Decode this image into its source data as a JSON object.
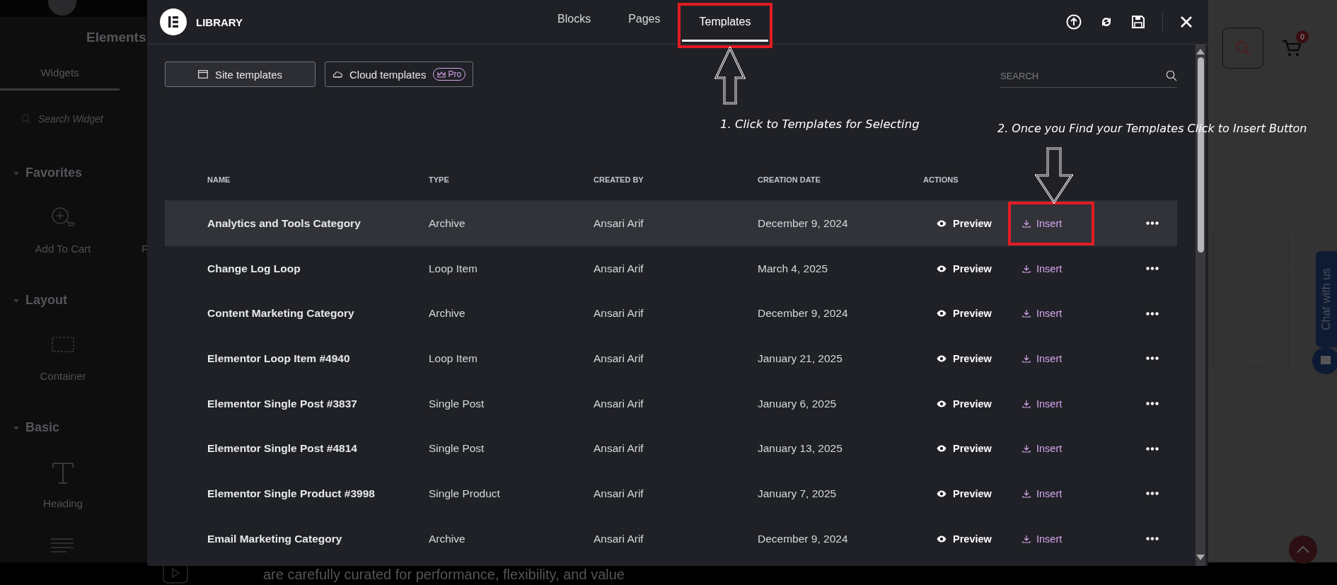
{
  "editor": {
    "panel_title": "Elements",
    "tabs": [
      {
        "label": "Widgets",
        "selected": true
      }
    ],
    "search": {
      "placeholder": "Search Widget"
    },
    "categories": [
      {
        "title": "Favorites",
        "expanded": true,
        "widgets": [
          {
            "label": "Add To Cart",
            "kind": "cart"
          },
          {
            "label": "F",
            "kind": "none"
          }
        ]
      },
      {
        "title": "Layout",
        "expanded": true,
        "widgets": [
          {
            "label": "Container",
            "kind": "container"
          }
        ]
      },
      {
        "title": "Basic",
        "expanded": true,
        "widgets": [
          {
            "label": "Heading",
            "kind": "heading"
          }
        ]
      }
    ]
  },
  "page": {
    "cart_count": "0",
    "body_text": "are carefully curated for performance, flexibility, and value",
    "chat_label": "Chat with us"
  },
  "library": {
    "title": "LIBRARY",
    "tabs": [
      {
        "label": "Blocks",
        "selected": false,
        "highlighted": false
      },
      {
        "label": "Pages",
        "selected": false,
        "highlighted": false
      },
      {
        "label": "Templates",
        "selected": true,
        "highlighted": true
      }
    ],
    "filters": [
      {
        "label": "Site templates",
        "selected": true,
        "kind": "site"
      },
      {
        "label": "Cloud templates",
        "selected": false,
        "kind": "cloud",
        "badge": "Pro"
      }
    ],
    "search": {
      "placeholder": "SEARCH"
    },
    "columns": [
      "NAME",
      "TYPE",
      "CREATED BY",
      "CREATION DATE",
      "ACTIONS"
    ],
    "rows": [
      {
        "name": "Analytics and Tools Category",
        "type": "Archive",
        "author": "Ansari Arif",
        "date": "December 9, 2024",
        "preview": "Preview",
        "insert": "Insert",
        "selected": true,
        "highlighted": true
      },
      {
        "name": "Change Log Loop",
        "type": "Loop Item",
        "author": "Ansari Arif",
        "date": "March 4, 2025",
        "preview": "Preview",
        "insert": "Insert",
        "selected": false,
        "highlighted": false
      },
      {
        "name": "Content Marketing Category",
        "type": "Archive",
        "author": "Ansari Arif",
        "date": "December 9, 2024",
        "preview": "Preview",
        "insert": "Insert",
        "selected": false,
        "highlighted": false
      },
      {
        "name": "Elementor Loop Item #4940",
        "type": "Loop Item",
        "author": "Ansari Arif",
        "date": "January 21, 2025",
        "preview": "Preview",
        "insert": "Insert",
        "selected": false,
        "highlighted": false
      },
      {
        "name": "Elementor Single Post #3837",
        "type": "Single Post",
        "author": "Ansari Arif",
        "date": "January 6, 2025",
        "preview": "Preview",
        "insert": "Insert",
        "selected": false,
        "highlighted": false
      },
      {
        "name": "Elementor Single Post #4814",
        "type": "Single Post",
        "author": "Ansari Arif",
        "date": "January 13, 2025",
        "preview": "Preview",
        "insert": "Insert",
        "selected": false,
        "highlighted": false
      },
      {
        "name": "Elementor Single Product #3998",
        "type": "Single Product",
        "author": "Ansari Arif",
        "date": "January 7, 2025",
        "preview": "Preview",
        "insert": "Insert",
        "selected": false,
        "highlighted": false
      },
      {
        "name": "Email Marketing Category",
        "type": "Archive",
        "author": "Ansari Arif",
        "date": "December 9, 2024",
        "preview": "Preview",
        "insert": "Insert",
        "selected": false,
        "highlighted": false
      }
    ]
  },
  "annotations": [
    {
      "text": "1. Click to Templates for Selecting"
    },
    {
      "text": "2. Once you Find your Templates Click to Insert Button"
    }
  ]
}
